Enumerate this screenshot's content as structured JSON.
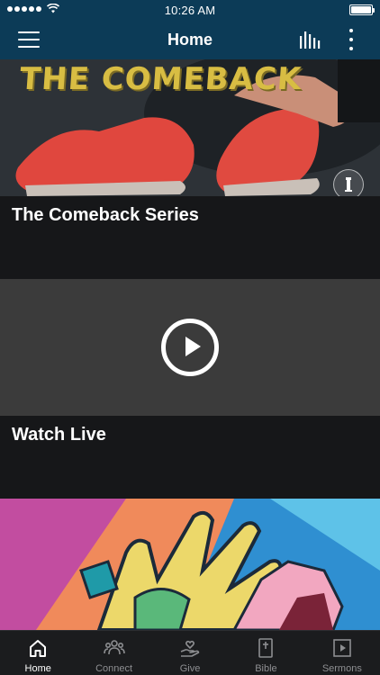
{
  "status_bar": {
    "time": "10:26 AM"
  },
  "nav": {
    "title": "Home"
  },
  "cards": [
    {
      "image_text": "THE COMEBACK",
      "title": "The Comeback Series"
    },
    {
      "title": "Watch Live"
    }
  ],
  "tabs": [
    {
      "label": "Home",
      "icon": "home-icon",
      "active": true
    },
    {
      "label": "Connect",
      "icon": "people-icon",
      "active": false
    },
    {
      "label": "Give",
      "icon": "give-heart-hand-icon",
      "active": false
    },
    {
      "label": "Bible",
      "icon": "bible-icon",
      "active": false
    },
    {
      "label": "Sermons",
      "icon": "video-play-icon",
      "active": false
    }
  ],
  "colors": {
    "header": "#0c3b57",
    "background": "#0f1114",
    "caption": "#161719",
    "tab_active": "#ffffff",
    "tab_inactive": "#8d8e91"
  }
}
